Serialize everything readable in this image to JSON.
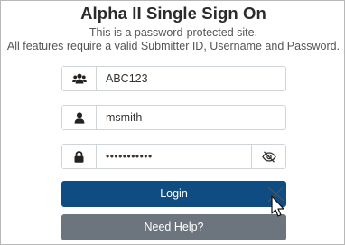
{
  "header": {
    "title": "Alpha II Single Sign On",
    "subtitle1": "This is a password-protected site.",
    "subtitle2": "All features require a valid Submitter ID, Username and Password."
  },
  "form": {
    "submitter_id": {
      "value": "ABC123",
      "icon": "users-icon"
    },
    "username": {
      "value": "msmith",
      "icon": "user-icon"
    },
    "password": {
      "masked_value": "•••••••••••",
      "icon": "lock-icon",
      "toggle_icon": "eye-slash-icon"
    }
  },
  "buttons": {
    "login_label": "Login",
    "help_label": "Need Help?"
  },
  "colors": {
    "login_bg": "#0f4c81",
    "help_bg": "#6c757d",
    "border": "#cfd4d9"
  }
}
